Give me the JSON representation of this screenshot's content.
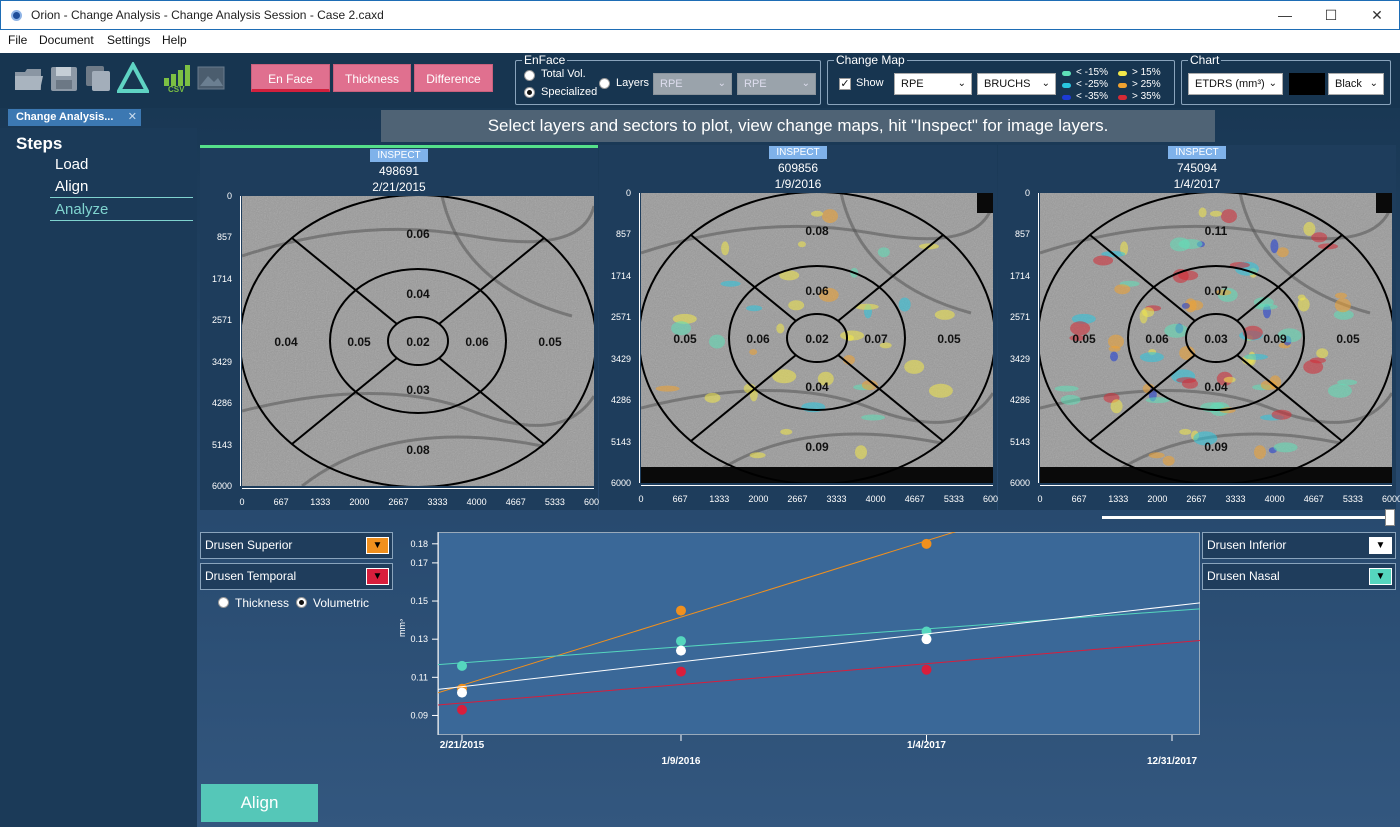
{
  "window": {
    "title": "Orion - Change Analysis - Change Analysis Session - Case 2.caxd",
    "minimize": "—",
    "maximize": "☐",
    "close": "✕"
  },
  "menu": [
    "File",
    "Document",
    "Settings",
    "Help"
  ],
  "toolbar": {
    "csv_label": "CSV",
    "buttons": {
      "en_face": "En Face",
      "thickness": "Thickness",
      "difference": "Difference"
    }
  },
  "enface": {
    "legend": "EnFace",
    "total_vol": "Total Vol.",
    "specialized": "Specialized",
    "layers": "Layers",
    "layer1": "RPE",
    "layer2": "RPE"
  },
  "change_map": {
    "legend": "Change Map",
    "show": "Show",
    "layer1": "RPE",
    "layer2": "BRUCHS",
    "check": "✓",
    "legend_items": [
      {
        "label": "< -15%",
        "color": "#5fe0b8"
      },
      {
        "label": "< -25%",
        "color": "#29c6e0"
      },
      {
        "label": "< -35%",
        "color": "#1c3bd6"
      },
      {
        "label": "> 15%",
        "color": "#f2e84a"
      },
      {
        "label": "> 25%",
        "color": "#f0a330"
      },
      {
        "label": "> 35%",
        "color": "#d42a35"
      }
    ]
  },
  "chart_group": {
    "legend": "Chart",
    "measure": "ETDRS (mm³)",
    "color_name": "Black"
  },
  "tab": {
    "label": "Change Analysis...",
    "close": "✕"
  },
  "steps": {
    "title": "Steps",
    "items": [
      "Load",
      "Align",
      "Analyze"
    ]
  },
  "banner": "Select layers and sectors to plot, view change maps, hit \"Inspect\" for image layers.",
  "panels": [
    {
      "inspect": "INSPECT",
      "id": "498691",
      "date": "2/21/2015",
      "sectors": {
        "center": "0.02",
        "inner_top": "0.04",
        "inner_left": "0.05",
        "inner_right": "0.06",
        "inner_bottom": "0.03",
        "outer_top": "0.06",
        "outer_left": "0.04",
        "outer_right": "0.05",
        "outer_bottom": "0.08"
      }
    },
    {
      "inspect": "INSPECT",
      "id": "609856",
      "date": "1/9/2016",
      "sectors": {
        "center": "0.02",
        "inner_top": "0.06",
        "inner_left": "0.06",
        "inner_right": "0.07",
        "inner_bottom": "0.04",
        "outer_top": "0.08",
        "outer_left": "0.05",
        "outer_right": "0.05",
        "outer_bottom": "0.09"
      }
    },
    {
      "inspect": "INSPECT",
      "id": "745094",
      "date": "1/4/2017",
      "sectors": {
        "center": "0.03",
        "inner_top": "0.07",
        "inner_left": "0.06",
        "inner_right": "0.09",
        "inner_bottom": "0.04",
        "outer_top": "0.11",
        "outer_left": "0.05",
        "outer_right": "0.05",
        "outer_bottom": "0.09"
      }
    }
  ],
  "image_axis": {
    "y_ticks": [
      "0",
      "857",
      "1714",
      "2571",
      "3429",
      "4286",
      "5143",
      "6000"
    ],
    "x_ticks": [
      "0",
      "667",
      "1333",
      "2000",
      "2667",
      "3333",
      "4000",
      "4667",
      "5333",
      "6000"
    ]
  },
  "series_selectors": {
    "left": [
      {
        "label": "Drusen Superior",
        "color": "#f0901e"
      },
      {
        "label": "Drusen Temporal",
        "color": "#d81e3c"
      }
    ],
    "right": [
      {
        "label": "Drusen Inferior",
        "color": "#ffffff"
      },
      {
        "label": "Drusen Nasal",
        "color": "#55d6be"
      }
    ],
    "arrow": "▼"
  },
  "mode": {
    "thickness": "Thickness",
    "volumetric": "Volumetric"
  },
  "chart_data": {
    "type": "scatter",
    "ylabel": "mm³",
    "x_labels": [
      "2/21/2015",
      "1/9/2016",
      "1/4/2017",
      "12/31/2017"
    ],
    "y_ticks": [
      "0.09",
      "0.11",
      "0.13",
      "0.15",
      "0.17",
      "0.18"
    ],
    "ylim": [
      0.085,
      0.182
    ],
    "xlim": [
      "2015-02-01",
      "2017-12-31"
    ],
    "series": [
      {
        "name": "Drusen Superior",
        "color": "#f0901e",
        "x": [
          "2015-02-21",
          "2016-01-09",
          "2017-01-04"
        ],
        "y": [
          0.104,
          0.145,
          0.18
        ]
      },
      {
        "name": "Drusen Nasal",
        "color": "#55d6be",
        "x": [
          "2015-02-21",
          "2016-01-09",
          "2017-01-04"
        ],
        "y": [
          0.116,
          0.129,
          0.134
        ]
      },
      {
        "name": "Drusen Inferior",
        "color": "#ffffff",
        "x": [
          "2015-02-21",
          "2016-01-09",
          "2017-01-04"
        ],
        "y": [
          0.102,
          0.124,
          0.13
        ]
      },
      {
        "name": "Drusen Temporal",
        "color": "#d81e3c",
        "x": [
          "2015-02-21",
          "2016-01-09",
          "2017-01-04"
        ],
        "y": [
          0.093,
          0.113,
          0.114
        ]
      }
    ]
  },
  "align_button": "Align"
}
